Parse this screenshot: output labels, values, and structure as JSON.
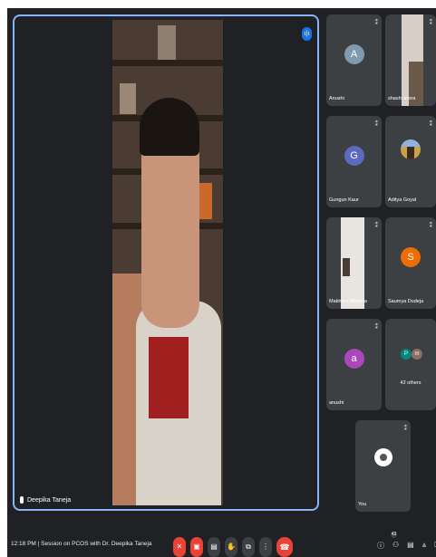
{
  "main": {
    "speaker_name": "Deepika Taneja",
    "speaking_icon": "audio-wave-icon"
  },
  "participants": [
    {
      "name": "Anushi",
      "initial": "A",
      "color": "#7f9caf",
      "type": "avatar"
    },
    {
      "name": "shashi arora",
      "type": "video"
    },
    {
      "name": "Gungun Kaur",
      "initial": "G",
      "color": "#5c6bc0",
      "type": "avatar"
    },
    {
      "name": "Aditya Goyal",
      "type": "photo"
    },
    {
      "name": "Makhani Makhna",
      "type": "video"
    },
    {
      "name": "Saumya Dudeja",
      "initial": "S",
      "color": "#ef6c00",
      "type": "avatar"
    },
    {
      "name": "anushi",
      "initial": "a",
      "color": "#ab47bc",
      "type": "avatar"
    },
    {
      "name": "42 others",
      "initials": [
        "P",
        "m"
      ],
      "type": "group"
    },
    {
      "name": "You",
      "type": "self"
    }
  ],
  "bottom_bar": {
    "time": "12:18 PM",
    "separator": "|",
    "meeting_title": "Session on PCOS with Dr. Deepika Taneja",
    "participant_count_badge": "43",
    "controls": [
      "mic-off-icon",
      "camera-off-icon",
      "captions-icon",
      "raise-hand-icon",
      "present-icon",
      "more-options-icon",
      "end-call-icon"
    ]
  }
}
